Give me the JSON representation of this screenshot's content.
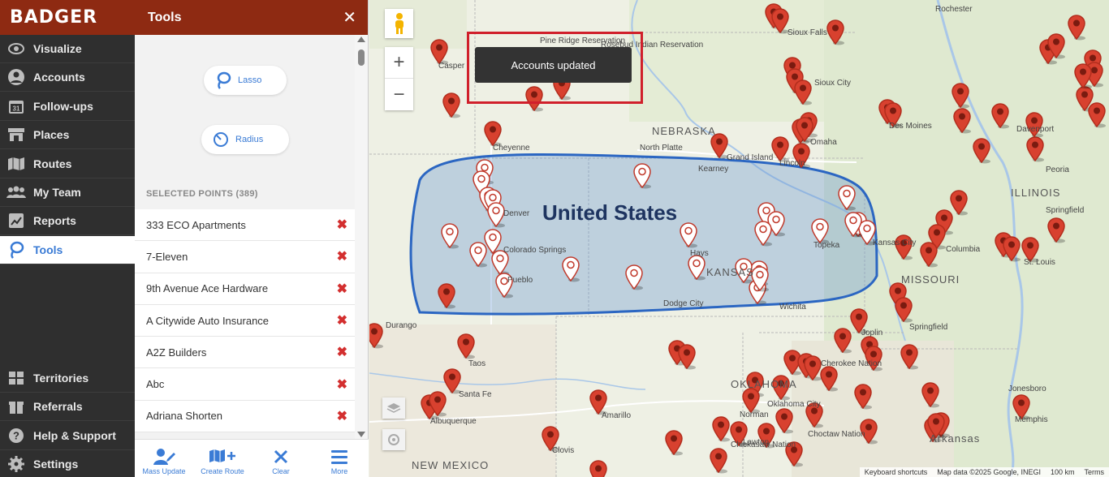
{
  "brand": "BADGER",
  "nav": {
    "items": [
      {
        "label": "Visualize",
        "icon": "eye-icon"
      },
      {
        "label": "Accounts",
        "icon": "person-icon"
      },
      {
        "label": "Follow-ups",
        "icon": "calendar-icon",
        "cal_day": "31"
      },
      {
        "label": "Places",
        "icon": "store-icon"
      },
      {
        "label": "Routes",
        "icon": "map-icon"
      },
      {
        "label": "My Team",
        "icon": "team-icon"
      },
      {
        "label": "Reports",
        "icon": "chart-icon"
      },
      {
        "label": "Tools",
        "icon": "lasso-icon",
        "active": true
      }
    ],
    "bottom_items": [
      {
        "label": "Territories",
        "icon": "grid-icon"
      },
      {
        "label": "Referrals",
        "icon": "gift-icon"
      },
      {
        "label": "Help & Support",
        "icon": "help-icon"
      },
      {
        "label": "Settings",
        "icon": "gear-icon"
      }
    ]
  },
  "panel": {
    "title": "Tools",
    "close": "✕",
    "lasso_label": "Lasso",
    "radius_label": "Radius",
    "selected_heading": "SELECTED POINTS (389)",
    "remove_glyph": "✖",
    "selected": [
      "333 ECO Apartments",
      "7-Eleven",
      "9th Avenue Ace Hardware",
      "A Citywide Auto Insurance",
      "A2Z Builders",
      "Abc",
      "Adriana Shorten"
    ],
    "footer": [
      {
        "label": "Mass Update",
        "icon": "mass-update-icon"
      },
      {
        "label": "Create Route",
        "icon": "create-route-icon"
      },
      {
        "label": "Clear",
        "icon": "clear-icon"
      },
      {
        "label": "More",
        "icon": "more-icon"
      }
    ]
  },
  "map": {
    "toast": "Accounts updated",
    "country_label": "United States",
    "state_labels": [
      "NEBRASKA",
      "ILLINOIS",
      "MISSOURI",
      "NEW MEXICO",
      "KANSAS",
      "OKLAHOMA"
    ],
    "city_labels": [
      "Rochester",
      "Sioux Falls",
      "Des Moines",
      "Davenport",
      "Omaha",
      "North Platte",
      "Grand Island",
      "Kearney",
      "Cheyenne",
      "Casper",
      "Peoria",
      "Springfield",
      "Denver",
      "Colorado Springs",
      "Pueblo",
      "Dodge City",
      "Topeka",
      "Kansas City",
      "Columbia",
      "St. Louis",
      "Joplin",
      "Springfield",
      "Durango",
      "Taos",
      "Santa Fe",
      "Albuquerque",
      "Amarillo",
      "Oklahoma City",
      "Norman",
      "Clovis",
      "Jonesboro",
      "Memphis",
      "Wichita",
      "Lincoln",
      "Sioux City",
      "Hays",
      "Lawton",
      "Arkansas",
      "Cherokee Nation",
      "Choctaw Nation",
      "Chickasaw Nation",
      "Pine Ridge Reservation",
      "Rosebud Indian Reservation"
    ],
    "zoom_in": "+",
    "zoom_out": "−",
    "attribution": [
      "Keyboard shortcuts",
      "Map data ©2025 Google, INEGI",
      "100 km",
      "Terms"
    ]
  }
}
